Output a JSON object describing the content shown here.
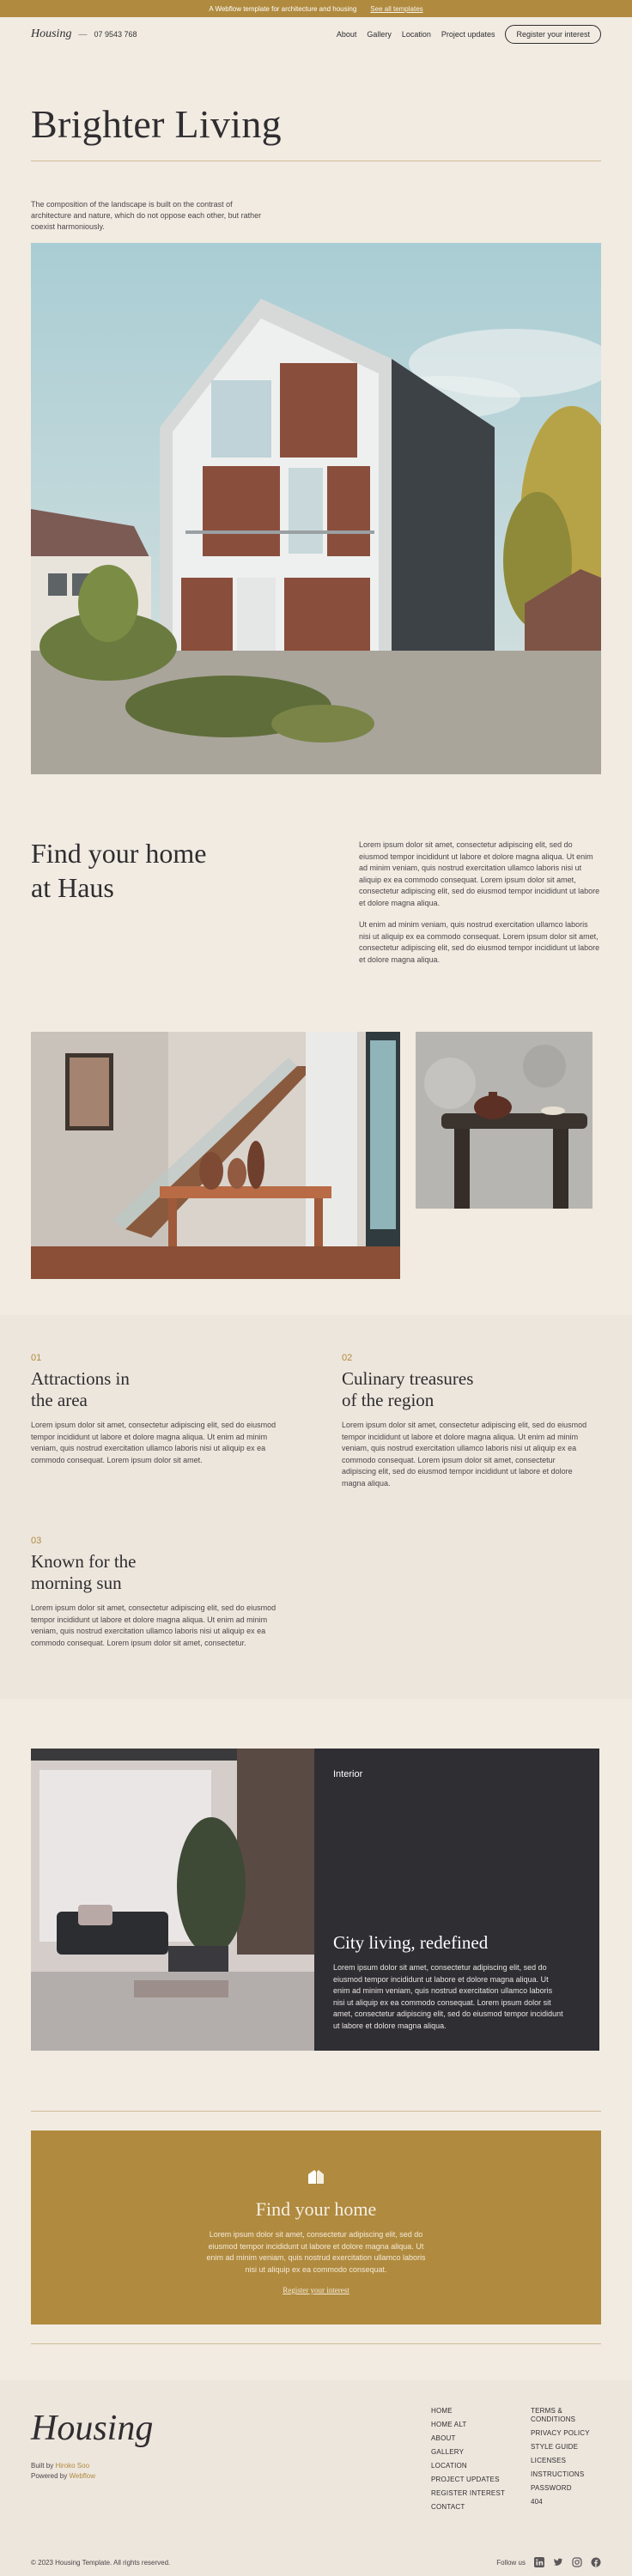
{
  "announcement": {
    "text": "A Webflow template for architecture and housing",
    "link": "See all templates"
  },
  "nav": {
    "logo": "Housing",
    "dash": "—",
    "phone": "07 9543 768",
    "links": [
      "About",
      "Gallery",
      "Location",
      "Project updates"
    ],
    "cta": "Register your interest"
  },
  "hero": {
    "title": "Brighter Living",
    "intro": "The composition of the landscape is built on the contrast of architecture and nature, which do not oppose each other, but rather coexist harmoniously."
  },
  "find": {
    "title_line1": "Find your home",
    "title_line2": "at Haus",
    "para1": "Lorem ipsum dolor sit amet, consectetur adipiscing elit, sed do eiusmod tempor incididunt ut labore et dolore magna aliqua. Ut enim ad minim veniam, quis nostrud exercitation ullamco laboris nisi ut aliquip ex ea commodo consequat. Lorem ipsum dolor sit amet, consectetur adipiscing elit, sed do eiusmod tempor incididunt ut labore et dolore magna aliqua.",
    "para2": "Ut enim ad minim veniam, quis nostrud exercitation ullamco laboris nisi ut aliquip ex ea commodo consequat. Lorem ipsum dolor sit amet, consectetur adipiscing elit, sed do eiusmod tempor incididunt ut labore et dolore magna aliqua."
  },
  "features": [
    {
      "num": "01",
      "title_line1": "Attractions in",
      "title_line2": "the area",
      "text": "Lorem ipsum dolor sit amet, consectetur adipiscing elit, sed do eiusmod tempor incididunt ut labore et dolore magna aliqua. Ut enim ad minim veniam, quis nostrud exercitation ullamco laboris nisi ut aliquip ex ea commodo consequat. Lorem ipsum dolor sit amet."
    },
    {
      "num": "02",
      "title_line1": "Culinary treasures",
      "title_line2": "of the region",
      "text": "Lorem ipsum dolor sit amet, consectetur adipiscing elit, sed do eiusmod tempor incididunt ut labore et dolore magna aliqua. Ut enim ad minim veniam, quis nostrud exercitation ullamco laboris nisi ut aliquip ex ea commodo consequat. Lorem ipsum dolor sit amet, consectetur adipiscing elit, sed do eiusmod tempor incididunt ut labore et dolore magna aliqua."
    },
    {
      "num": "03",
      "title_line1": "Known for the",
      "title_line2": "morning sun",
      "text": "Lorem ipsum dolor sit amet, consectetur adipiscing elit, sed do eiusmod tempor incididunt ut labore et dolore magna aliqua. Ut enim ad minim veniam, quis nostrud exercitation ullamco laboris nisi ut aliquip ex ea commodo consequat. Lorem ipsum dolor sit amet, consectetur."
    }
  ],
  "interior": {
    "tag": "Interior",
    "title": "City living, redefined",
    "text": "Lorem ipsum dolor sit amet, consectetur adipiscing elit, sed do eiusmod tempor incididunt ut labore et dolore magna aliqua. Ut enim ad minim veniam, quis nostrud exercitation ullamco laboris nisi ut aliquip ex ea commodo consequat. Lorem ipsum dolor sit amet, consectetur adipiscing elit, sed do eiusmod tempor incididunt ut labore et dolore magna aliqua."
  },
  "cta": {
    "title": "Find your home",
    "text": "Lorem ipsum dolor sit amet, consectetur adipiscing elit, sed do eiusmod tempor incididunt ut labore et dolore magna aliqua. Ut enim ad minim veniam, quis nostrud exercitation ullamco laboris nisi ut aliquip ex ea commodo consequat.",
    "link": "Register your interest"
  },
  "footer": {
    "logo": "Housing",
    "built_by_prefix": "Built by",
    "built_by_name": "Hiroko Soo",
    "powered_by_prefix": "Powered by",
    "powered_by_name": "Webflow",
    "col1": [
      "HOME",
      "HOME ALT",
      "ABOUT",
      "GALLERY",
      "LOCATION",
      "PROJECT UPDATES",
      "REGISTER INTEREST",
      "CONTACT"
    ],
    "col2_terms": "TERMS & CONDITIONS",
    "col2": [
      "PRIVACY POLICY",
      "STYLE GUIDE",
      "LICENSES",
      "INSTRUCTIONS",
      "PASSWORD",
      "404"
    ],
    "copyright": "© 2023 Housing Template. All rights reserved.",
    "follow": "Follow us",
    "socials": [
      "linkedin-icon",
      "twitter-icon",
      "instagram-icon",
      "facebook-icon"
    ]
  },
  "colors": {
    "background": "#f1ebe2",
    "accent": "#b08a3e",
    "dark": "#2f2e33"
  }
}
